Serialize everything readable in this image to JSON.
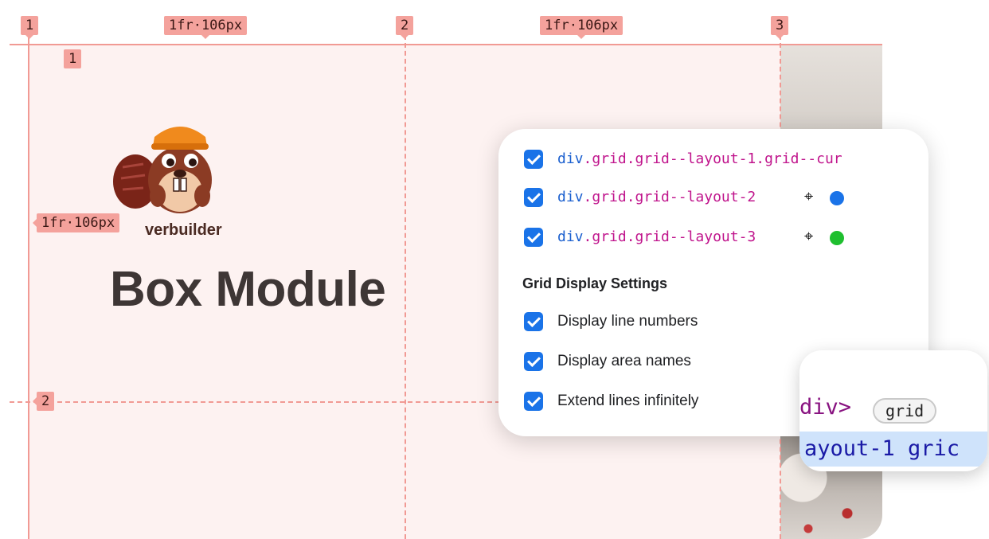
{
  "overlay": {
    "col_numbers": [
      "1",
      "2",
      "3"
    ],
    "col_track_sizes": [
      "1fr·106px",
      "1fr·106px"
    ],
    "row_numbers": [
      "1",
      "2"
    ],
    "row_track_size": "1fr·106px",
    "line_color": "#f19a94"
  },
  "page": {
    "logo_text": "verbuilder",
    "heading": "Box Module"
  },
  "grid_panel": {
    "grids": [
      {
        "label": "div.grid.grid--layout-1.grid--cur",
        "checked": true
      },
      {
        "label": "div.grid.grid--layout-2",
        "checked": true,
        "color": "#1a73e8",
        "icon": "crosshair-icon"
      },
      {
        "label": "div.grid.grid--layout-3",
        "checked": true,
        "color": "#1fbf2f",
        "icon": "crosshair-icon"
      }
    ],
    "settings_title": "Grid Display Settings",
    "settings": [
      {
        "label": "Display line numbers",
        "checked": true
      },
      {
        "label": "Display area names",
        "checked": true
      },
      {
        "label": "Extend lines infinitely",
        "checked": true
      }
    ]
  },
  "code_panel": {
    "line1": "div>",
    "badge": "grid",
    "line2": "ayout-1 gric"
  }
}
